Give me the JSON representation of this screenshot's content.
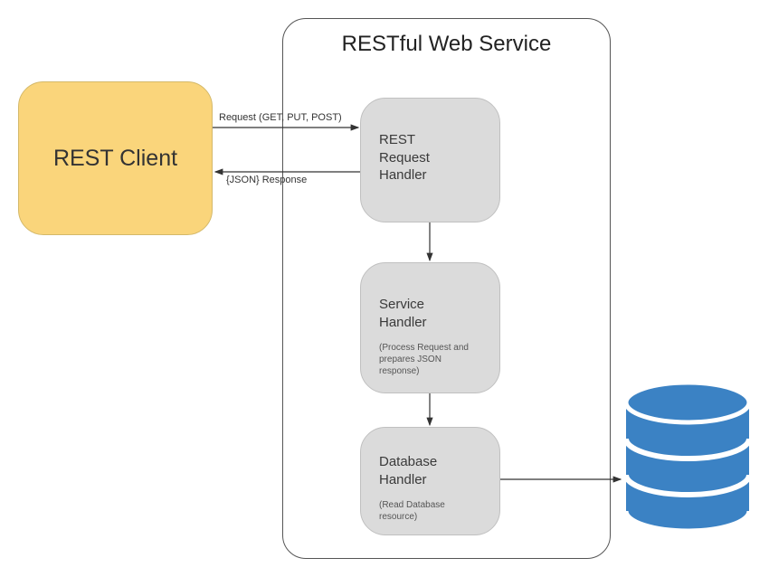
{
  "client": {
    "title": "REST Client"
  },
  "service": {
    "title": "RESTful Web Service",
    "request_handler": {
      "title": "REST\nRequest\nHandler"
    },
    "service_handler": {
      "title": "Service\nHandler",
      "subtitle": "(Process Request and prepares JSON response)"
    },
    "database_handler": {
      "title": "Database\nHandler",
      "subtitle": "(Read Database resource)"
    }
  },
  "labels": {
    "request": "Request (GET, PUT, POST)",
    "response": "{JSON} Response"
  },
  "database": {
    "name": "database"
  }
}
